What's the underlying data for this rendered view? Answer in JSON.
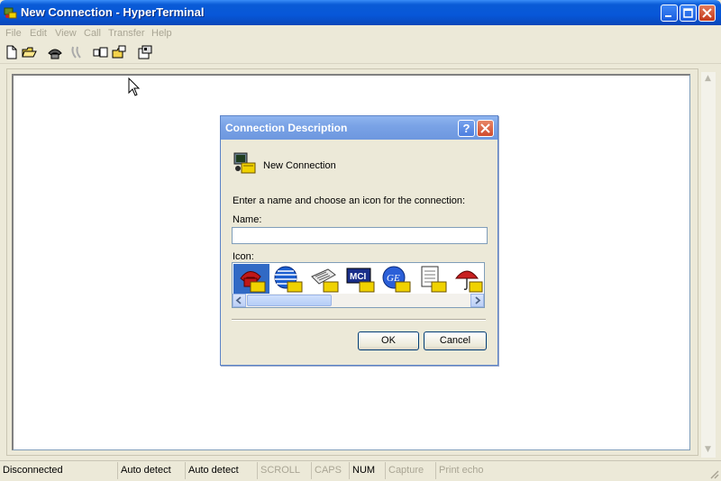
{
  "window": {
    "title": "New Connection - HyperTerminal"
  },
  "menu": {
    "items": [
      "File",
      "Edit",
      "View",
      "Call",
      "Transfer",
      "Help"
    ]
  },
  "toolbar": {
    "buttons": [
      "new-icon",
      "open-icon",
      "phone-icon",
      "hangup-icon",
      "send-icon",
      "receive-icon",
      "properties-icon"
    ]
  },
  "dialog": {
    "title": "Connection Description",
    "help_label": "?",
    "connection_name": "New Connection",
    "instruction": "Enter a name and choose an icon for the connection:",
    "name_label": "Name:",
    "name_value": "",
    "icon_label": "Icon:",
    "icons": [
      "phone-icon",
      "globe-icon",
      "fax-icon",
      "mci-icon",
      "ge-icon",
      "document-icon",
      "umbrella-icon"
    ],
    "selected_icon_index": 0,
    "mci_text": "MCI",
    "ge_text": "GE",
    "ok_label": "OK",
    "cancel_label": "Cancel"
  },
  "status": {
    "connection": "Disconnected",
    "detect1": "Auto detect",
    "detect2": "Auto detect",
    "scroll": "SCROLL",
    "caps": "CAPS",
    "num": "NUM",
    "capture": "Capture",
    "print_echo": "Print echo"
  },
  "colors": {
    "titlebar": "#0757d8",
    "dialog_title": "#7aa3e6",
    "selection": "#316ac5",
    "close_button": "#c4391b"
  }
}
